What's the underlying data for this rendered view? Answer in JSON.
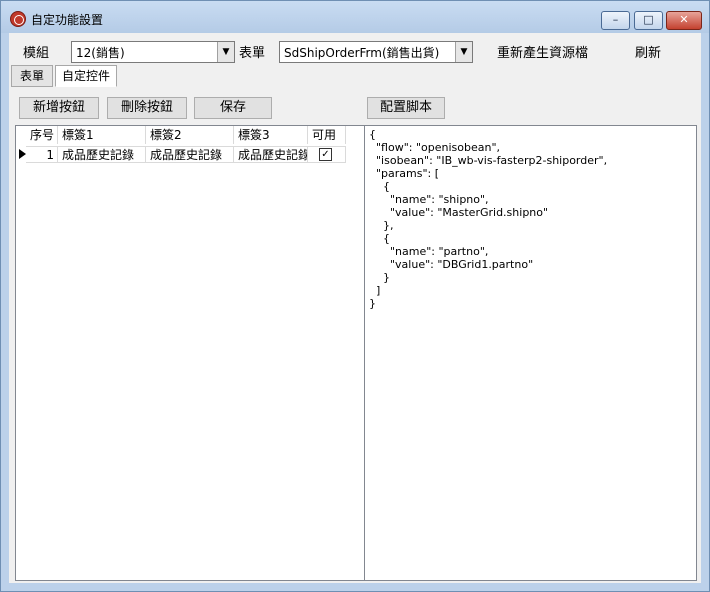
{
  "window": {
    "title": "自定功能設置"
  },
  "top": {
    "module_label": "模組",
    "module_value": "12(銷售)",
    "form_label": "表單",
    "form_value": "SdShipOrderFrm(銷售出貨)",
    "regenerate_label": "重新產生資源檔",
    "refresh_label": "刷新"
  },
  "tabs": [
    {
      "label": "表單"
    },
    {
      "label": "自定控件"
    }
  ],
  "buttons": {
    "add": "新增按鈕",
    "delete": "刪除按鈕",
    "save": "保存",
    "script": "配置脚本"
  },
  "grid": {
    "columns": [
      "序号",
      "標簽1",
      "標簽2",
      "標簽3",
      "可用"
    ],
    "rows": [
      {
        "seq": "1",
        "label1": "成品歷史記錄",
        "label2": "成品歷史記錄",
        "label3": "成品歷史記錄",
        "enabled": true
      }
    ]
  },
  "script": {
    "lines": [
      "{",
      "  \"flow\": \"openisobean\",",
      "  \"isobean\": \"IB_wb-vis-fasterp2-shiporder\",",
      "  \"params\": [",
      "    {",
      "      \"name\": \"shipno\",",
      "      \"value\": \"MasterGrid.shipno\"",
      "    },",
      "    {",
      "      \"name\": \"partno\",",
      "      \"value\": \"DBGrid1.partno\"",
      "    }",
      "  ]",
      "}"
    ]
  }
}
